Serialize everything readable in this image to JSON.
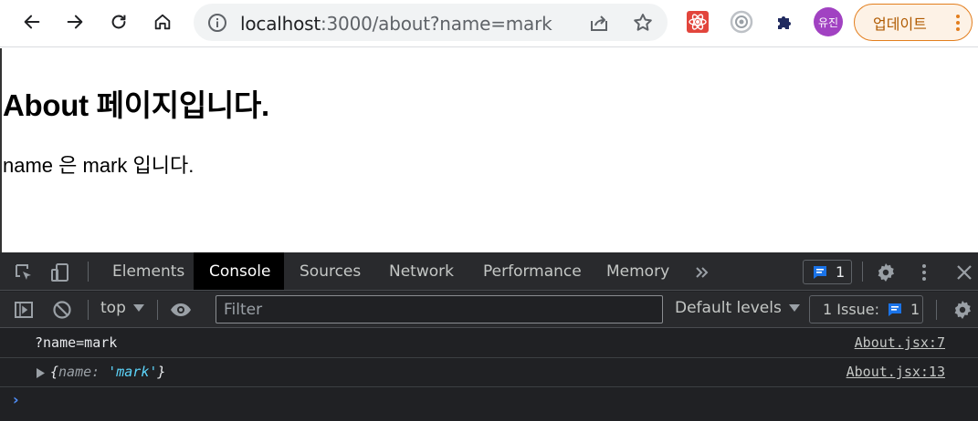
{
  "browser": {
    "url_host": "localhost",
    "url_path": ":3000/about?name=mark",
    "profile_label": "유진",
    "update_label": "업데이트",
    "nav_icons": [
      "back-icon",
      "forward-icon",
      "reload-icon",
      "home-icon"
    ],
    "extension_icons": [
      "react-devtools-icon",
      "chrome-extension-icon",
      "puzzle-extensions-icon"
    ]
  },
  "page": {
    "heading": "About 페이지입니다.",
    "text": "name 은 mark 입니다."
  },
  "devtools": {
    "tabs": [
      {
        "label": "Elements",
        "active": false
      },
      {
        "label": "Console",
        "active": true
      },
      {
        "label": "Sources",
        "active": false
      },
      {
        "label": "Network",
        "active": false
      },
      {
        "label": "Performance",
        "active": false
      },
      {
        "label": "Memory",
        "active": false
      }
    ],
    "message_count": "1",
    "context": "top",
    "filter_placeholder": "Filter",
    "levels_label": "Default levels",
    "issues_label": "1 Issue:",
    "issues_count": "1",
    "logs": [
      {
        "text": "?name=mark",
        "source": "About.jsx:7"
      },
      {
        "object_open": "{",
        "object_key": "name",
        "object_colon": ":",
        "object_value": "'mark'",
        "object_close": "}",
        "source": "About.jsx:13"
      }
    ],
    "prompt": "›"
  },
  "colors": {
    "accent_blue": "#1a73e8",
    "devtools_bg": "#202124",
    "update_border": "#e37e1d",
    "profile_bg": "#a142c2",
    "string_value": "#5cd5fb"
  }
}
